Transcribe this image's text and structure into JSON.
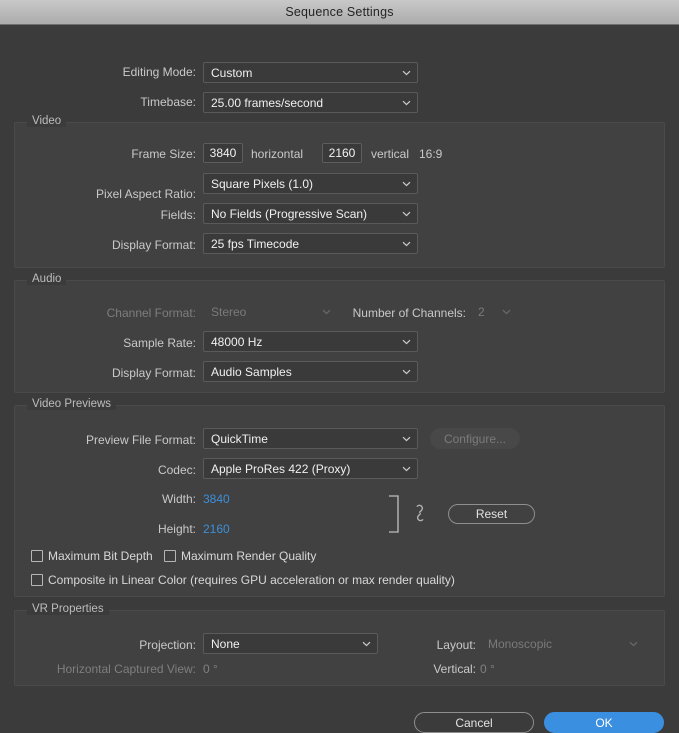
{
  "window": {
    "title": "Sequence Settings"
  },
  "top": {
    "editing_mode_label": "Editing Mode:",
    "editing_mode_value": "Custom",
    "timebase_label": "Timebase:",
    "timebase_value": "25.00  frames/second"
  },
  "video": {
    "group_title": "Video",
    "frame_size_label": "Frame Size:",
    "frame_width": "3840",
    "horizontal_label": "horizontal",
    "frame_height": "2160",
    "vertical_label": "vertical",
    "aspect_ratio_text": "16:9",
    "pixel_aspect_label": "Pixel Aspect Ratio:",
    "pixel_aspect_value": "Square Pixels (1.0)",
    "fields_label": "Fields:",
    "fields_value": "No Fields (Progressive Scan)",
    "display_format_label": "Display Format:",
    "display_format_value": "25 fps Timecode"
  },
  "audio": {
    "group_title": "Audio",
    "channel_format_label": "Channel Format:",
    "channel_format_value": "Stereo",
    "number_of_channels_label": "Number of Channels:",
    "number_of_channels_value": "2",
    "sample_rate_label": "Sample Rate:",
    "sample_rate_value": "48000 Hz",
    "display_format_label": "Display Format:",
    "display_format_value": "Audio Samples"
  },
  "video_previews": {
    "group_title": "Video Previews",
    "preview_file_format_label": "Preview File Format:",
    "preview_file_format_value": "QuickTime",
    "configure_label": "Configure...",
    "codec_label": "Codec:",
    "codec_value": "Apple ProRes 422 (Proxy)",
    "width_label": "Width:",
    "width_value": "3840",
    "height_label": "Height:",
    "height_value": "2160",
    "reset_label": "Reset",
    "max_bit_depth_label": "Maximum Bit Depth",
    "max_bit_depth_checked": false,
    "max_render_quality_label": "Maximum Render Quality",
    "max_render_quality_checked": false,
    "composite_linear_label": "Composite in Linear Color (requires GPU acceleration or max render quality)",
    "composite_linear_checked": false
  },
  "vr": {
    "group_title": "VR Properties",
    "projection_label": "Projection:",
    "projection_value": "None",
    "layout_label": "Layout:",
    "layout_value": "Monoscopic",
    "horizontal_captured_view_label": "Horizontal Captured View:",
    "horizontal_captured_view_value": "0 °",
    "vertical_label": "Vertical:",
    "vertical_value": "0 °"
  },
  "footer": {
    "cancel_label": "Cancel",
    "ok_label": "OK"
  },
  "colors": {
    "accent": "#3b8fe0",
    "hot_text": "#3d8fd8",
    "dialog_bg": "#3b3b3b",
    "group_bg": "#414141",
    "titlebar": "#bdbdbd"
  }
}
